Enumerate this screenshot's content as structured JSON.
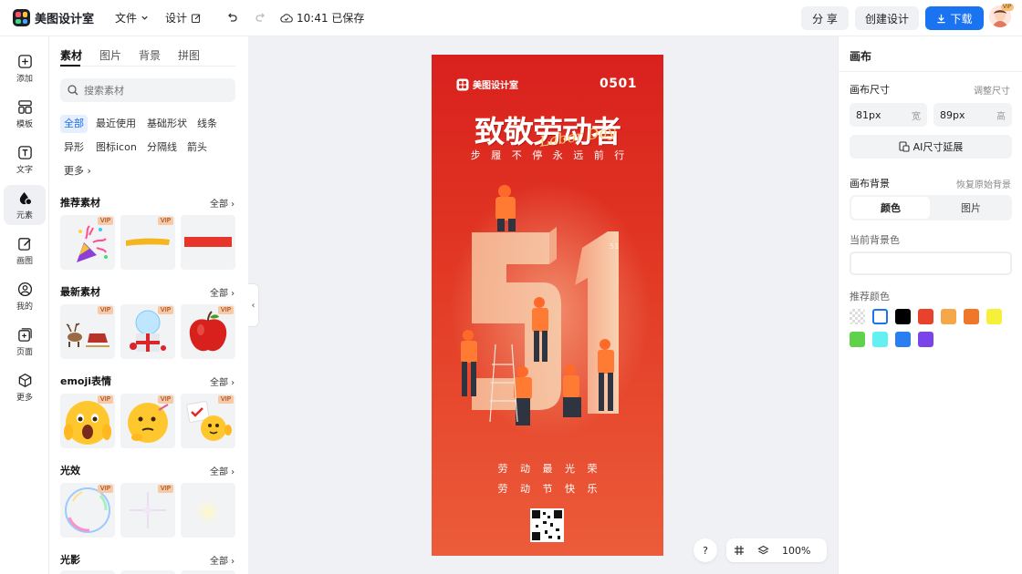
{
  "app": {
    "name": "美图设计室"
  },
  "topbar": {
    "file_label": "文件",
    "design_label": "设计",
    "save_status": "10:41 已保存",
    "share_label": "分 享",
    "create_label": "创建设计",
    "download_label": "下载",
    "vip_label": "VIP"
  },
  "rail": [
    {
      "label": "添加",
      "icon": "plus-box-icon"
    },
    {
      "label": "模板",
      "icon": "template-icon"
    },
    {
      "label": "文字",
      "icon": "text-icon"
    },
    {
      "label": "元素",
      "icon": "shapes-icon"
    },
    {
      "label": "画图",
      "icon": "pen-icon"
    },
    {
      "label": "我的",
      "icon": "user-icon"
    },
    {
      "label": "页面",
      "icon": "page-add-icon"
    },
    {
      "label": "更多",
      "icon": "cube-icon"
    }
  ],
  "panel": {
    "tabs": [
      "素材",
      "图片",
      "背景",
      "拼图"
    ],
    "search_placeholder": "搜索素材",
    "chips": [
      "全部",
      "最近使用",
      "基础形状",
      "线条",
      "异形",
      "图标icon",
      "分隔线",
      "箭头",
      "更多"
    ],
    "all_label": "全部",
    "vip_tag": "VIP",
    "sections": [
      {
        "title": "推荐素材",
        "items": [
          "party-popper",
          "yellow-brush-stroke",
          "red-rectangle"
        ]
      },
      {
        "title": "最新素材",
        "items": [
          "reindeer-sleigh",
          "snow-globe-gift",
          "red-apple"
        ]
      },
      {
        "title": "emoji表情",
        "items": [
          "shocked-emoji",
          "thinking-emoji",
          "check-emoji"
        ]
      },
      {
        "title": "光效",
        "items": [
          "rainbow-bubble",
          "sparkle-light",
          "soft-glow"
        ]
      },
      {
        "title": "光影",
        "items": []
      }
    ]
  },
  "poster": {
    "brand": "美图设计室",
    "date": "0501",
    "headline": "致敬劳动者",
    "script_text": "Labor Day",
    "subline": "步 履 不 停 永 远 前 行",
    "big_number": "51",
    "slogan1": "劳 动 最 光 荣",
    "slogan2": "劳 动 节 快 乐"
  },
  "bottombar": {
    "help": "?",
    "zoom": "100%"
  },
  "rightpanel": {
    "title": "画布",
    "size_label": "画布尺寸",
    "adjust_label": "调整尺寸",
    "width_value": "81px",
    "width_unit": "宽",
    "height_value": "89px",
    "height_unit": "高",
    "ai_extend": "AI尺寸延展",
    "bg_label": "画布背景",
    "restore_label": "恢复原始背景",
    "bg_tabs": [
      "颜色",
      "图片"
    ],
    "current_bg": "当前背景色",
    "recommend": "推荐颜色",
    "colors": [
      "transparent",
      "#ffffff",
      "#000000",
      "#e8412c",
      "#f5a84a",
      "#f0762a",
      "#f7f03a",
      "#5fd14a",
      "#62f0f0",
      "#2b7ef0",
      "#7a44e8"
    ]
  }
}
